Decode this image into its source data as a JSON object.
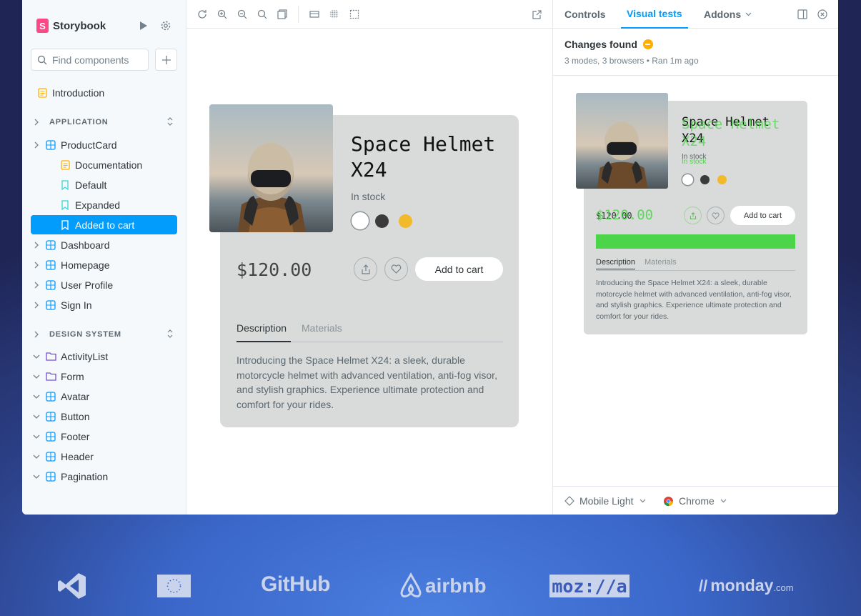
{
  "app": {
    "name": "Storybook"
  },
  "sidebar": {
    "search_placeholder": "Find components",
    "intro": "Introduction",
    "sections": [
      {
        "title": "APPLICATION"
      },
      {
        "title": "DESIGN SYSTEM"
      }
    ],
    "application_items": [
      {
        "label": "ProductCard"
      },
      {
        "label": "Documentation"
      },
      {
        "label": "Default"
      },
      {
        "label": "Expanded"
      },
      {
        "label": "Added to cart"
      },
      {
        "label": "Dashboard"
      },
      {
        "label": "Homepage"
      },
      {
        "label": "User Profile"
      },
      {
        "label": "Sign In"
      }
    ],
    "design_items": [
      {
        "label": "ActivityList"
      },
      {
        "label": "Form"
      },
      {
        "label": "Avatar"
      },
      {
        "label": "Button"
      },
      {
        "label": "Footer"
      },
      {
        "label": "Header"
      },
      {
        "label": "Pagination"
      }
    ]
  },
  "product": {
    "title_line1": "Space Helmet",
    "title_line2": "X24",
    "stock": "In stock",
    "price": "$120.00",
    "add_to_cart": "Add to cart",
    "tab_description": "Description",
    "tab_materials": "Materials",
    "description": "Introducing the Space Helmet X24: a sleek, durable motorcycle helmet with advanced ventilation, anti-fog visor, and stylish graphics. Experience ultimate protection and comfort for your rides.",
    "swatch_colors": [
      "#ffffff",
      "#3b3b3b",
      "#f2b92b"
    ]
  },
  "panel": {
    "tabs": {
      "controls": "Controls",
      "visual_tests": "Visual tests",
      "addons": "Addons"
    },
    "changes_title": "Changes found",
    "changes_meta": "3 modes, 3 browsers • Ran 1m ago",
    "diff_price_new": "$120.00",
    "mode": "Mobile Light",
    "browser": "Chrome"
  },
  "colors": {
    "accent": "#029cfd",
    "diff_green": "#4cd44a",
    "warning": "#ffae00"
  },
  "logos": {
    "github": "GitHub",
    "airbnb": "airbnb",
    "mozilla": "moz://a",
    "monday": "monday",
    "monday_suffix": ".com"
  }
}
